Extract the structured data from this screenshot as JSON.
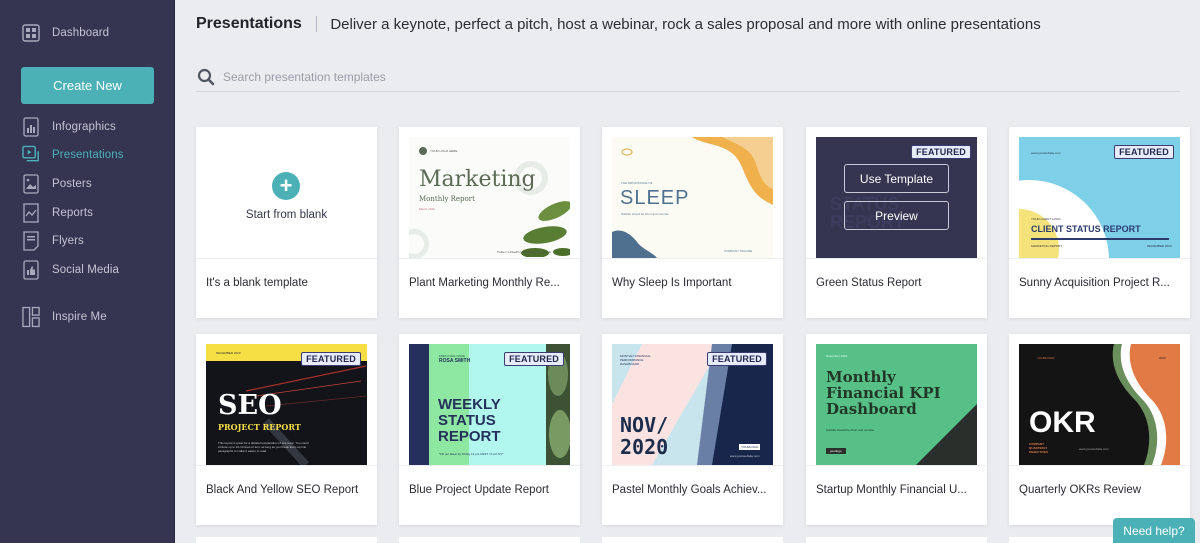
{
  "sidebar": {
    "dashboard": {
      "label": "Dashboard",
      "icon": "dashboard-grid-icon"
    },
    "create_new": "Create New",
    "items": [
      {
        "label": "Infographics",
        "icon": "bar-chart-icon",
        "active": false
      },
      {
        "label": "Presentations",
        "icon": "presentation-icon",
        "active": true
      },
      {
        "label": "Posters",
        "icon": "image-icon",
        "active": false
      },
      {
        "label": "Reports",
        "icon": "line-chart-icon",
        "active": false
      },
      {
        "label": "Flyers",
        "icon": "document-icon",
        "active": false
      },
      {
        "label": "Social Media",
        "icon": "thumbs-up-icon",
        "active": false
      }
    ],
    "inspire": {
      "label": "Inspire Me",
      "icon": "layout-icon"
    }
  },
  "header": {
    "title": "Presentations",
    "subtitle": "Deliver a keynote, perfect a pitch, host a webinar, rock a sales proposal and more with online presentations"
  },
  "search": {
    "placeholder": "Search presentation templates",
    "value": ""
  },
  "blank_card": {
    "label": "Start from blank",
    "name": "It's a blank template"
  },
  "featured_label": "FEATURED",
  "hover": {
    "use_template": "Use Template",
    "preview": "Preview"
  },
  "templates": [
    {
      "name": "Plant Marketing Monthly Re...",
      "featured": false,
      "thumb": {
        "title": "Marketing",
        "subtitle": "Monthly Report",
        "date": "March 2020",
        "logo": "YOUR LOGO HERE",
        "footer": "Twitter | LinkedIn | Instagram | Facebook"
      }
    },
    {
      "name": "Why Sleep Is Important",
      "featured": false,
      "thumb": {
        "kicker": "THE IMPORTANCE OF",
        "title": "SLEEP",
        "subtitle": "Subtitle shoud be short and concise",
        "footer": "COMPANY TAGLINE"
      }
    },
    {
      "name": "Green Status Report",
      "featured": true,
      "hovered": true,
      "thumb": {
        "title": "STATUS REPORT"
      }
    },
    {
      "name": "Sunny Acquisition Project R...",
      "featured": true,
      "thumb": {
        "site": "www.yourwebsite.com",
        "logo": "YOUR CLIENT LOGO",
        "title": "CLIENT STATUS REPORT",
        "left": "MARKETING REPORT",
        "right": "DECEMBER 2020"
      }
    },
    {
      "name": "Black And Yellow SEO Report",
      "featured": true,
      "thumb": {
        "date": "DECEMBER 2020",
        "title": "SEO",
        "subtitle": "PROJECT REPORT",
        "body": "This layout is great for a detailed explanation of one topic. You could include up to 10-14 lines of text, as long as you break them up into paragraphs to make it easier to read."
      }
    },
    {
      "name": "Blue Project Update Report",
      "featured": true,
      "thumb": {
        "label": "EMPLOYEE NAME",
        "employee": "ROSA SMITH",
        "title1": "WEEKLY",
        "title2": "STATUS",
        "title3": "REPORT",
        "note": "*Fill out latest by Friday 12 pm CEST / 6 pm NY*"
      }
    },
    {
      "name": "Pastel Monthly Goals Achiev...",
      "featured": true,
      "thumb": {
        "kicker": "MONTHLY FINANCIAL PERFORMANCE DASHBOARD",
        "title1": "NOV/",
        "title2": "2020",
        "logo": "YOURLOGO",
        "site": "www.yourwebsite.com"
      }
    },
    {
      "name": "Startup Monthly Financial U...",
      "featured": false,
      "thumb": {
        "date": "November 2020",
        "title1": "Monthly",
        "title2": "Financial KPI",
        "title3": "Dashboard",
        "subtitle": "Subtitle should be short and concise",
        "logo": "yourlogo"
      }
    },
    {
      "name": "Quarterly OKRs Review",
      "featured": false,
      "thumb": {
        "logo": "YOURLOGO",
        "year": "2020",
        "title": "OKR",
        "subtitle": "COMPANY QUARTERLY OBJECTIVES",
        "site": "www.yourwebsite.com"
      }
    }
  ],
  "help": "Need help?",
  "colors": {
    "sidebar_bg": "#353451",
    "accent": "#4cb1b6",
    "page_bg": "#ebecf0"
  }
}
